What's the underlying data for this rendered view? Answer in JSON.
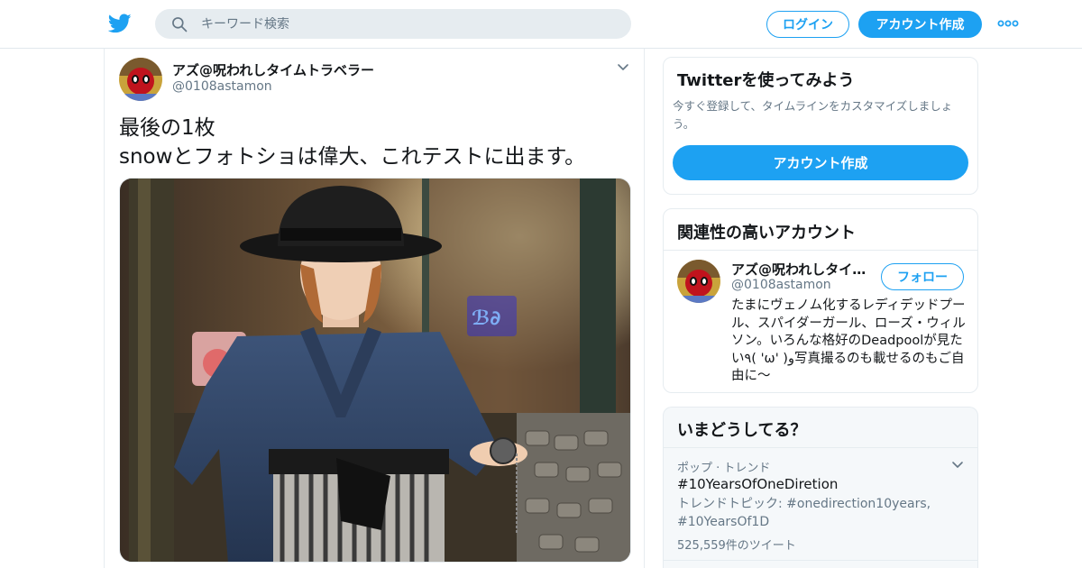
{
  "header": {
    "logo_icon": "twitter-bird-icon",
    "search": {
      "icon": "search-icon",
      "placeholder": "キーワード検索"
    },
    "login_label": "ログイン",
    "signup_label": "アカウント作成",
    "more_icon": "more-dots-icon",
    "accent_color": "#1da1f2"
  },
  "tweet": {
    "author_name": "アズ@呪われしタイムトラベラー",
    "author_handle": "@0108astamon",
    "menu_icon": "chevron-down-icon",
    "text_line1": "最後の1枚",
    "text_line2": "snowとフォトショは偉大、これテストに出ます。",
    "photo": "photo-person-in-hat-holding-pocket-watch"
  },
  "sidebar": {
    "signup_card": {
      "title": "Twitterを使ってみよう",
      "description": "今すぐ登録して、タイムラインをカスタマイズしましょう。",
      "button_label": "アカウント作成"
    },
    "related_card": {
      "title": "関連性の高いアカウント",
      "account": {
        "name": "アズ@呪われしタイ…",
        "handle": "@0108astamon",
        "follow_label": "フォロー",
        "bio": "たまにヴェノム化するレディデッドプール、スパイダーガール、ローズ・ウィルソン。いろんな格好のDeadpoolが見たい٩( 'ω' )و写真撮るのも載せるのもご自由に〜"
      }
    },
    "trends_card": {
      "title": "いまどうしてる？",
      "items": [
        {
          "category": "ポップ · トレンド",
          "name": "#10YearsOfOneDiretion",
          "description": "トレンドトピック: #onedirection10years, #10YearsOf1D",
          "count": "525,559件のツイート",
          "menu_icon": "chevron-down-icon"
        }
      ]
    }
  }
}
